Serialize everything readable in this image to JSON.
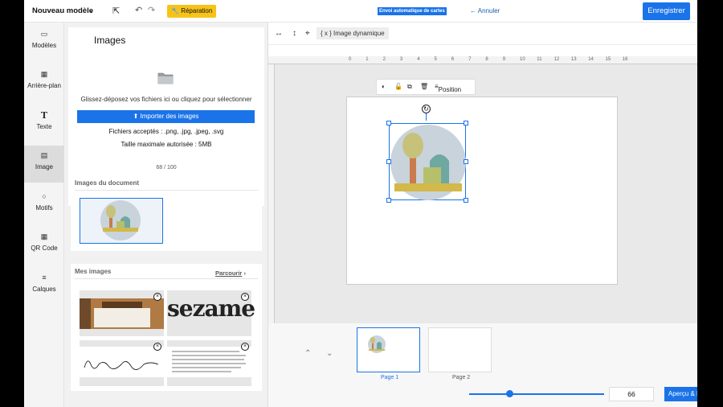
{
  "header": {
    "model_title": "Nouveau modèle",
    "repair_label": "Réparation",
    "auto_badge": "Envoi automatique de cartes",
    "undo_label": "Annuler",
    "save_label": "Enregistrer"
  },
  "rail": {
    "items": [
      {
        "label": "Modèles",
        "icon": "templates-icon"
      },
      {
        "label": "Arrière-plan",
        "icon": "background-icon"
      },
      {
        "label": "Texte",
        "icon": "text-icon"
      },
      {
        "label": "Image",
        "icon": "image-icon"
      },
      {
        "label": "Motifs",
        "icon": "shapes-icon"
      },
      {
        "label": "QR Code",
        "icon": "qrcode-icon"
      },
      {
        "label": "Calques",
        "icon": "layers-icon"
      }
    ]
  },
  "panel": {
    "title": "Images",
    "drop_text": "Glissez-déposez vos fichiers ici ou cliquez pour sélectionner",
    "import_label": "Importer des images",
    "accepted": "Fichiers acceptés : .png, .jpg, .jpeg, .svg",
    "max_size": "Taille maximale autorisée : 5MB",
    "count": "68 / 100",
    "doc_images_title": "Images du document",
    "my_images_title": "Mes images",
    "browse_label": "Parcourir",
    "sezame_text": "sezame",
    "signature_text": "Jean-Pierre Nadir"
  },
  "canvas": {
    "dynamic_label": "{ x } Image dynamique",
    "position_label": "Position",
    "ruler_ticks": [
      "0",
      "1",
      "2",
      "3",
      "4",
      "5",
      "6",
      "7",
      "8",
      "9",
      "10",
      "11",
      "12",
      "13",
      "14",
      "15",
      "16"
    ]
  },
  "bottom": {
    "page1": "Page 1",
    "page2": "Page 2",
    "zoom_value": "66",
    "zoom_fraction": 0.3,
    "export_label": "Aperçu & Export"
  },
  "colors": {
    "accent": "#1a73e8",
    "repair": "#f7c318"
  }
}
